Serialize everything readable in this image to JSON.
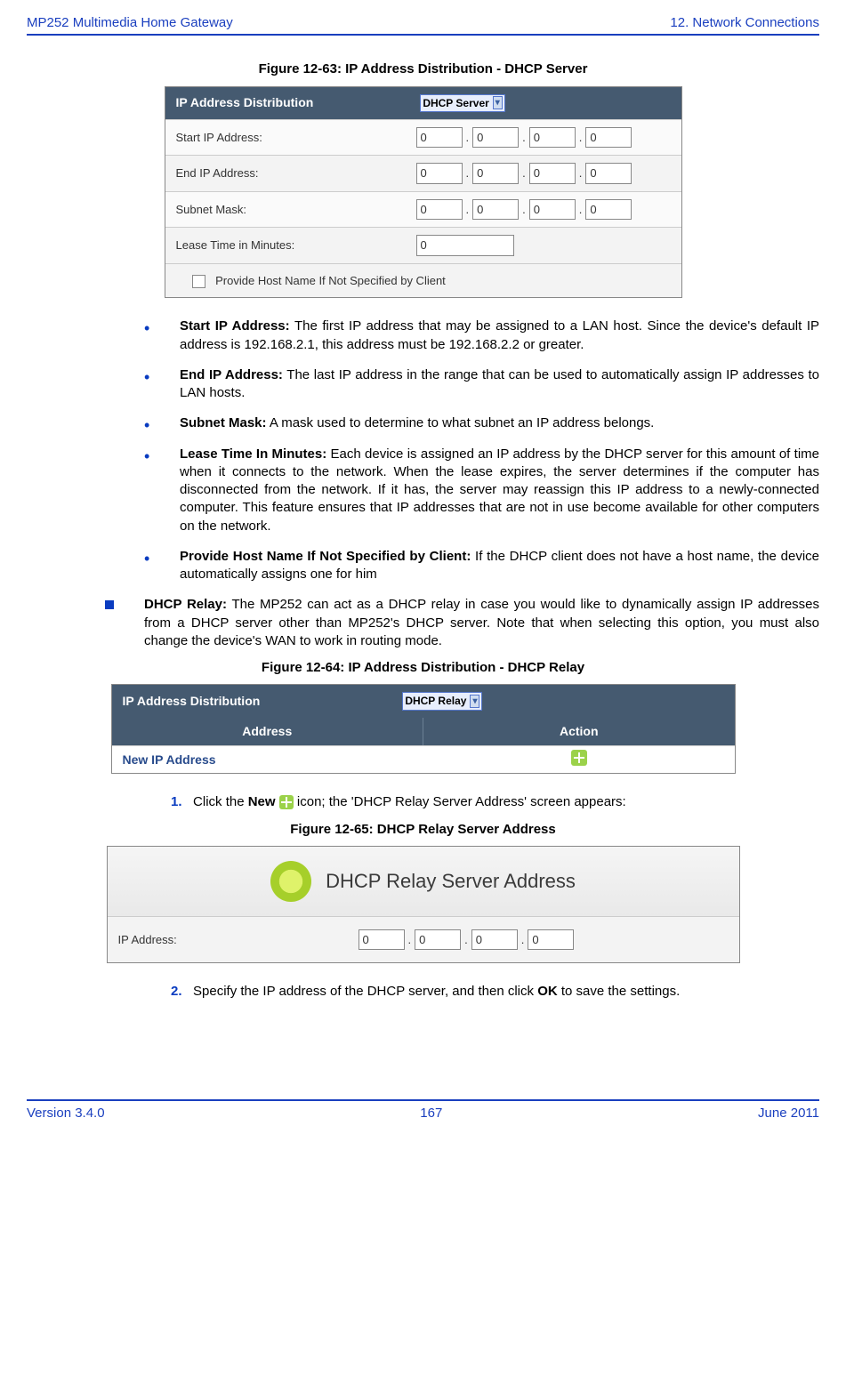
{
  "header": {
    "left": "MP252 Multimedia Home Gateway",
    "right": "12. Network Connections"
  },
  "fig1": {
    "caption": "Figure 12-63: IP Address Distribution - DHCP Server",
    "title": "IP Address Distribution",
    "select": "DHCP Server",
    "startLabel": "Start IP Address:",
    "endLabel": "End IP Address:",
    "subnetLabel": "Subnet Mask:",
    "leaseLabel": "Lease Time in Minutes:",
    "ip": {
      "a": "0",
      "b": "0",
      "c": "0",
      "d": "0"
    },
    "lease": "0",
    "hostRow": "Provide Host Name If Not Specified by Client"
  },
  "bullets": {
    "b1": {
      "label": "Start IP Address:",
      "text": " The first IP address that may be assigned to a LAN host. Since the device's default IP address is 192.168.2.1, this address must be 192.168.2.2 or greater."
    },
    "b2": {
      "label": "End IP Address:",
      "text": " The last IP address in the range that can be used to automatically assign IP addresses to LAN hosts."
    },
    "b3": {
      "label": "Subnet Mask:",
      "text": " A mask used to determine to what subnet an IP address belongs."
    },
    "b4": {
      "label": "Lease Time In Minutes:",
      "text": " Each device is assigned an IP address by the DHCP server for this amount of time when it connects to the network. When the lease expires, the server determines if the computer has disconnected from the network. If it has, the server may reassign this IP address to a newly-connected computer. This feature ensures that IP addresses that are not in use become available for other computers on the network."
    },
    "b5": {
      "label": "Provide Host Name If Not Specified by Client:",
      "text": " If the DHCP client does not have a host name, the device automatically assigns one for him"
    }
  },
  "relay": {
    "label": "DHCP Relay:",
    "text": " The MP252 can act as a DHCP relay in case you would like to dynamically assign IP addresses from a DHCP server other than MP252's DHCP server. Note that when selecting this option, you must also change the device's WAN to work in routing mode."
  },
  "fig2": {
    "caption": "Figure 12-64: IP Address Distribution - DHCP Relay",
    "title": "IP Address Distribution",
    "select": "DHCP Relay",
    "col1": "Address",
    "col2": "Action",
    "newRow": "New IP Address"
  },
  "step1": {
    "num": "1.",
    "pre": "Click the ",
    "newWord": "New",
    "post": " icon; the 'DHCP Relay Server Address' screen appears:"
  },
  "fig3": {
    "caption": "Figure 12-65: DHCP Relay Server Address",
    "title": "DHCP Relay Server Address",
    "ipLabel": "IP Address:",
    "ip": {
      "a": "0",
      "b": "0",
      "c": "0",
      "d": "0"
    }
  },
  "step2": {
    "num": "2.",
    "pre": "Specify the IP address of the DHCP server, and then click ",
    "ok": "OK",
    "post": " to save the settings."
  },
  "footer": {
    "left": "Version 3.4.0",
    "center": "167",
    "right": "June 2011"
  }
}
